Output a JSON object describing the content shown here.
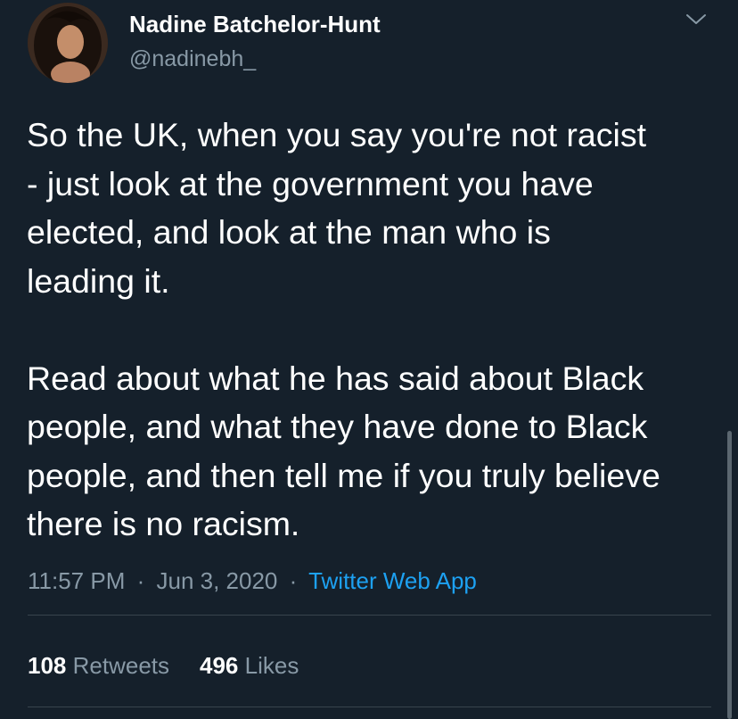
{
  "author": {
    "display_name": "Nadine Batchelor-Hunt",
    "handle": "@nadinebh_",
    "avatar_icon": "profile-photo"
  },
  "menu": {
    "icon": "chevron-down-icon"
  },
  "tweet": {
    "paragraph1_lines": [
      "So the UK, when you say you're not racist",
      "- just look at the government you have",
      "elected, and look at the man who is",
      "leading it."
    ],
    "paragraph2_lines": [
      "Read about what he has said about Black",
      "people, and what they have done to Black",
      "people, and then tell me if you truly believe",
      "there is no racism."
    ]
  },
  "meta": {
    "time": "11:57 PM",
    "separator": "·",
    "date": "Jun 3, 2020",
    "source": "Twitter Web App"
  },
  "stats": {
    "retweets_count": "108",
    "retweets_label": "Retweets",
    "likes_count": "496",
    "likes_label": "Likes"
  },
  "colors": {
    "background": "#15202b",
    "text": "#ffffff",
    "secondary_text": "#8899a6",
    "link": "#1da1f2",
    "divider": "#38444d"
  }
}
